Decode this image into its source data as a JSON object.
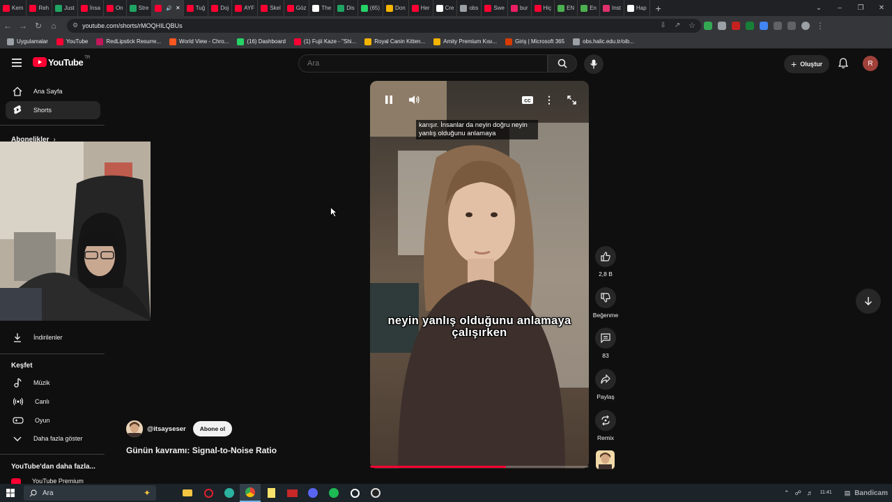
{
  "browser": {
    "tabs": [
      {
        "label": "Kem",
        "color": "#ff0033"
      },
      {
        "label": "Reh",
        "color": "#ff0033"
      },
      {
        "label": "Just",
        "color": "#1fa463"
      },
      {
        "label": "İnsa",
        "color": "#ff0033"
      },
      {
        "label": "On",
        "color": "#ff0033"
      },
      {
        "label": "Stre",
        "color": "#1fa463"
      },
      {
        "label": "",
        "color": "#ff0033",
        "active": true
      },
      {
        "label": "Tuğ",
        "color": "#ff0033"
      },
      {
        "label": "Doj",
        "color": "#ff0033"
      },
      {
        "label": "AYF",
        "color": "#ff0033"
      },
      {
        "label": "Skel",
        "color": "#ff0033"
      },
      {
        "label": "Göz",
        "color": "#ff0033"
      },
      {
        "label": "The",
        "color": "#ffffff"
      },
      {
        "label": "Dis",
        "color": "#1fa463"
      },
      {
        "label": "(65)",
        "color": "#25d366"
      },
      {
        "label": "Don",
        "color": "#f4b400"
      },
      {
        "label": "Her",
        "color": "#ff0033"
      },
      {
        "label": "Cre",
        "color": "#ffffff"
      },
      {
        "label": "obs",
        "color": "#9aa0a6"
      },
      {
        "label": "Swe",
        "color": "#ff0033"
      },
      {
        "label": "bur",
        "color": "#e91e63"
      },
      {
        "label": "Hiç",
        "color": "#ff0033"
      },
      {
        "label": "EN",
        "color": "#4caf50"
      },
      {
        "label": "En",
        "color": "#4caf50"
      },
      {
        "label": "Inst",
        "color": "#e1306c"
      },
      {
        "label": "Hap",
        "color": "#ffffff"
      }
    ],
    "new_tab": "+",
    "url": "youtube.com/shorts/rMOQHILQBUs",
    "bookmarks": [
      {
        "label": "Uygulamalar",
        "color": "#9aa0a6"
      },
      {
        "label": "YouTube",
        "color": "#ff0033"
      },
      {
        "label": "RedLipstick Resurre...",
        "color": "#c2185b"
      },
      {
        "label": "World View - Chro...",
        "color": "#ff5722"
      },
      {
        "label": "(16) Dashboard",
        "color": "#25d366"
      },
      {
        "label": "(1) Fujii Kaze - \"Shi...",
        "color": "#ff0033"
      },
      {
        "label": "Royal Canin Kitten...",
        "color": "#f4b400"
      },
      {
        "label": "Amity Premium Kısı...",
        "color": "#f4b400"
      },
      {
        "label": "Giriş | Microsoft 365",
        "color": "#d83b01"
      },
      {
        "label": "obs.halic.edu.tr/oib...",
        "color": "#9aa0a6"
      }
    ]
  },
  "youtube": {
    "logo_text": "YouTube",
    "logo_region": "TR",
    "search_placeholder": "Ara",
    "create_label": "Oluştur",
    "avatar_letter": "R",
    "sidebar": {
      "home": "Ana Sayfa",
      "shorts": "Shorts",
      "subscriptions": "Abonelikler",
      "downloads": "İndirilenler",
      "explore_heading": "Keşfet",
      "music": "Müzik",
      "live": "Canlı",
      "gaming": "Oyun",
      "show_more": "Daha fazla göster",
      "more_heading": "YouTube'dan daha fazla...",
      "premium": "YouTube Premium"
    },
    "short": {
      "caption_top": "karışır. İnsanlar da neyin doğru neyin yanlış olduğunu anlamaya",
      "caption_big": "neyin yanlış olduğunu anlamaya çalışırken",
      "progress": 0.62,
      "channel": "@itsayseser",
      "subscribe_label": "Abone ol",
      "title": "Günün kavramı: Signal-to-Noise Ratio"
    },
    "actions": {
      "likes": "2,8 B",
      "dislike": "Beğenme",
      "comments": "83",
      "share": "Paylaş",
      "remix": "Remix"
    }
  },
  "taskbar": {
    "search_placeholder": "Ara",
    "time": "11:41"
  },
  "watermark": "Bandicam"
}
